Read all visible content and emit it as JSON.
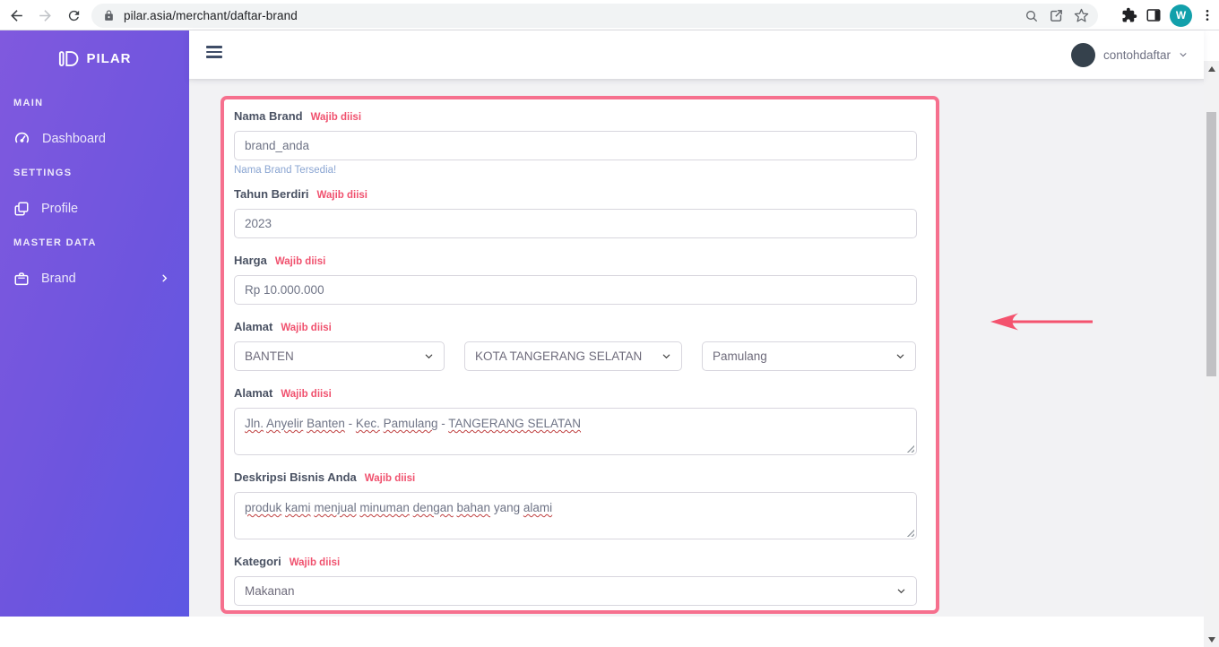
{
  "browser": {
    "url": "pilar.asia/merchant/daftar-brand",
    "profile_initial": "W"
  },
  "sidebar": {
    "logo_text": "PILAR",
    "sections": [
      {
        "label": "MAIN",
        "items": [
          {
            "label": "Dashboard",
            "icon": "gauge-icon"
          }
        ]
      },
      {
        "label": "SETTINGS",
        "items": [
          {
            "label": "Profile",
            "icon": "windows-icon"
          }
        ]
      },
      {
        "label": "MASTER DATA",
        "items": [
          {
            "label": "Brand",
            "icon": "briefcase-icon",
            "has_submenu": true
          }
        ]
      }
    ]
  },
  "header": {
    "user_name": "contohdaftar"
  },
  "form": {
    "required_label": "Wajib diisi",
    "nama_brand": {
      "label": "Nama Brand",
      "value": "brand_anda",
      "help": "Nama Brand Tersedia!"
    },
    "tahun_berdiri": {
      "label": "Tahun Berdiri",
      "value": "2023"
    },
    "harga": {
      "label": "Harga",
      "value": "Rp 10.000.000"
    },
    "alamat_wilayah": {
      "label": "Alamat",
      "provinsi": "BANTEN",
      "kota": "KOTA TANGERANG SELATAN",
      "kecamatan": "Pamulang"
    },
    "alamat_detail": {
      "label": "Alamat",
      "tokens": [
        {
          "t": "Jln.",
          "u": true
        },
        {
          "t": "Anyelir",
          "u": true
        },
        {
          "t": "Banten",
          "u": true
        },
        {
          "t": "-",
          "u": false
        },
        {
          "t": "Kec.",
          "u": true
        },
        {
          "t": "Pamulang",
          "u": true
        },
        {
          "t": "-",
          "u": false
        },
        {
          "t": "TANGERANG SELATAN",
          "u": true
        }
      ]
    },
    "deskripsi": {
      "label": "Deskripsi Bisnis Anda",
      "tokens": [
        {
          "t": "produk",
          "u": true
        },
        {
          "t": "kami",
          "u": true
        },
        {
          "t": "menjual",
          "u": true
        },
        {
          "t": "minuman",
          "u": true
        },
        {
          "t": "dengan",
          "u": true
        },
        {
          "t": "bahan",
          "u": true
        },
        {
          "t": "yang",
          "u": false
        },
        {
          "t": "alami",
          "u": true
        }
      ]
    },
    "kategori": {
      "label": "Kategori",
      "value": "Makanan"
    }
  },
  "colors": {
    "sidebar_purple_left": "#8059de",
    "sidebar_purple_right": "#5d57e3",
    "highlight_border_pink": "#f6708e",
    "annotation_arrow_red": "#f4536e",
    "required_red": "#f0516e",
    "help_blue": "#8aa5d2"
  }
}
